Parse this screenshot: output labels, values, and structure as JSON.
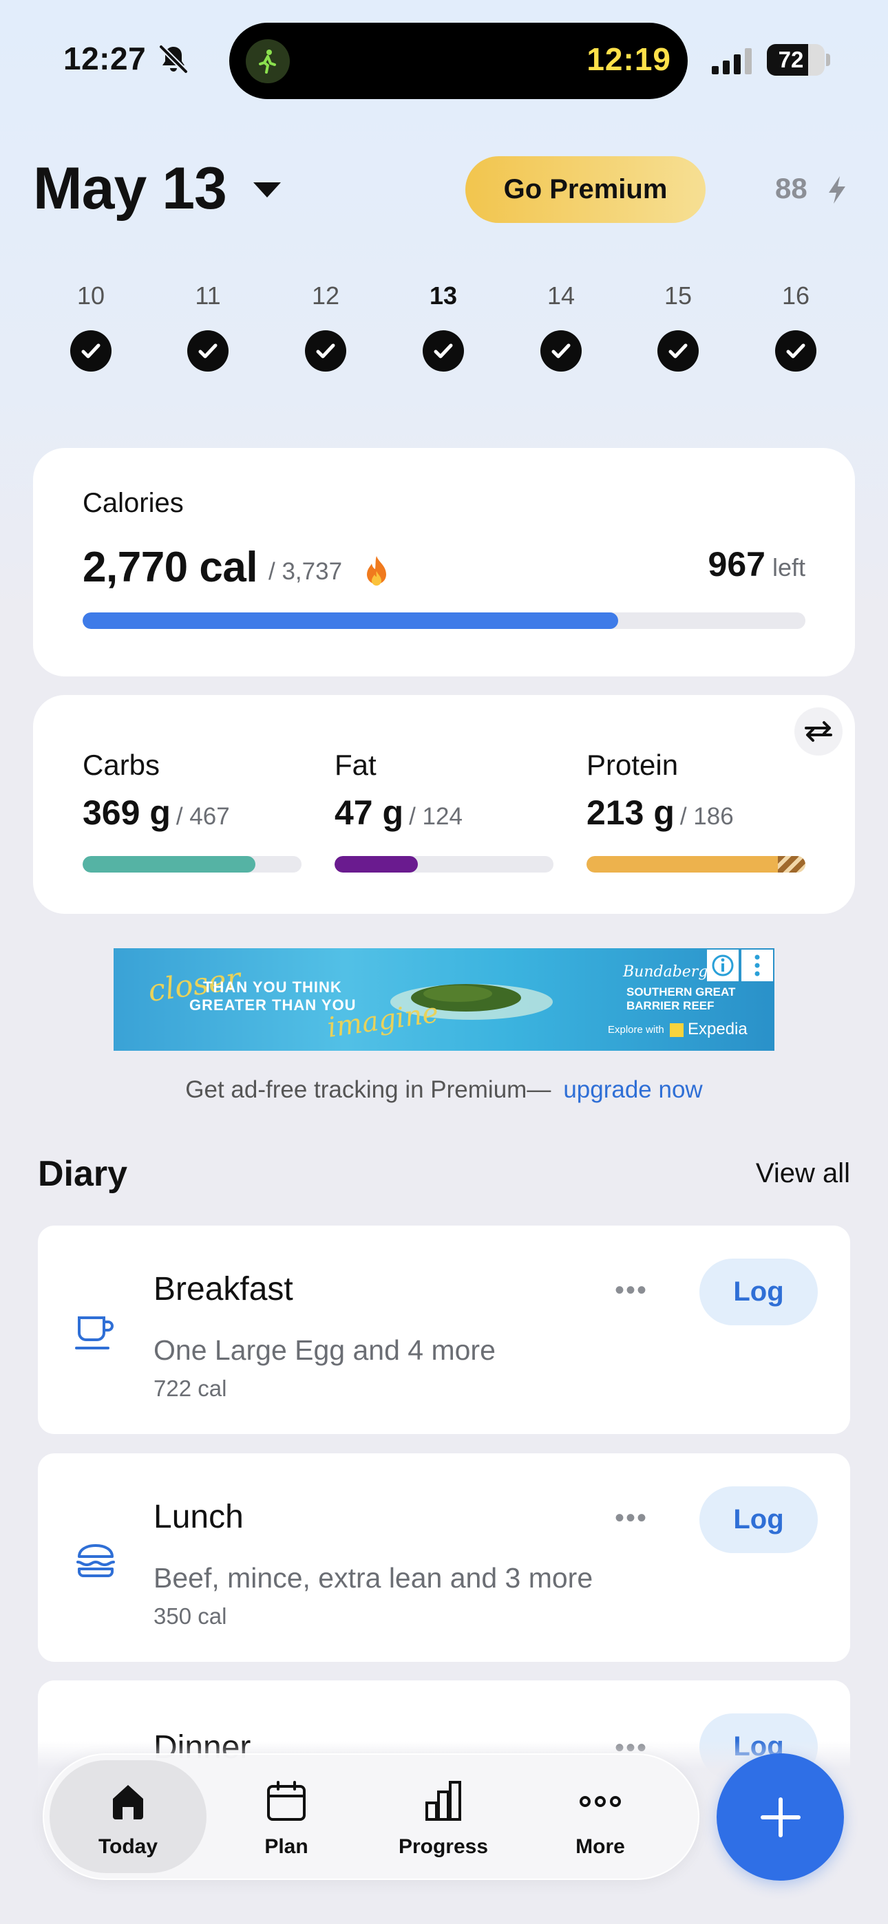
{
  "status_bar": {
    "time": "12:27",
    "island_timer": "12:19",
    "battery_percent": "72",
    "battery_level": 0.72
  },
  "header": {
    "date": "May 13",
    "premium_label": "Go Premium",
    "streak_count": "88"
  },
  "week": [
    {
      "num": "10",
      "checked": true
    },
    {
      "num": "11",
      "checked": true
    },
    {
      "num": "12",
      "checked": true
    },
    {
      "num": "13",
      "checked": true,
      "active": true
    },
    {
      "num": "14",
      "checked": true
    },
    {
      "num": "15",
      "checked": true
    },
    {
      "num": "16",
      "checked": true
    }
  ],
  "calories": {
    "label": "Calories",
    "consumed": "2,770 cal",
    "goal": "/ 3,737",
    "left_value": "967",
    "left_label": "left",
    "progress": 0.741,
    "color": "#3e7be8"
  },
  "macros": [
    {
      "name": "Carbs",
      "value": "369 g",
      "goal": "/ 467",
      "progress": 0.79,
      "color": "#55b3a4"
    },
    {
      "name": "Fat",
      "value": "47 g",
      "goal": "/ 124",
      "progress": 0.38,
      "color": "#6a1b8f"
    },
    {
      "name": "Protein",
      "value": "213 g",
      "goal": "/ 186",
      "progress": 1.0,
      "color": "#edb24d",
      "over": true
    }
  ],
  "ad": {
    "script1": "closer",
    "line1": "THAN YOU THINK",
    "line2": "GREATER THAN YOU",
    "script2": "imagine",
    "brand_script": "Bundaberg",
    "brand1": "SOUTHERN GREAT",
    "brand2": "BARRIER REEF",
    "explore": "Explore with",
    "expedia": "Expedia",
    "note": "Get ad-free tracking in Premium—",
    "note_link": "upgrade now"
  },
  "diary": {
    "title": "Diary",
    "view_all": "View all",
    "meals": [
      {
        "name": "Breakfast",
        "desc": "One Large Egg and 4 more",
        "cal": "722 cal",
        "log": "Log",
        "dots": "•••",
        "icon": "coffee-cup-icon"
      },
      {
        "name": "Lunch",
        "desc": "Beef, mince, extra lean and 3 more",
        "cal": "350 cal",
        "log": "Log",
        "dots": "•••",
        "icon": "burger-icon"
      },
      {
        "name": "Dinner",
        "desc": "",
        "cal": "",
        "log": "Log",
        "dots": "•••",
        "icon": "dinner-icon"
      }
    ]
  },
  "nav": {
    "tabs": [
      {
        "label": "Today",
        "icon": "home-icon",
        "active": true
      },
      {
        "label": "Plan",
        "icon": "calendar-icon"
      },
      {
        "label": "Progress",
        "icon": "bar-chart-icon"
      },
      {
        "label": "More",
        "icon": "more-dots-icon"
      }
    ],
    "fab_icon": "plus-icon"
  }
}
